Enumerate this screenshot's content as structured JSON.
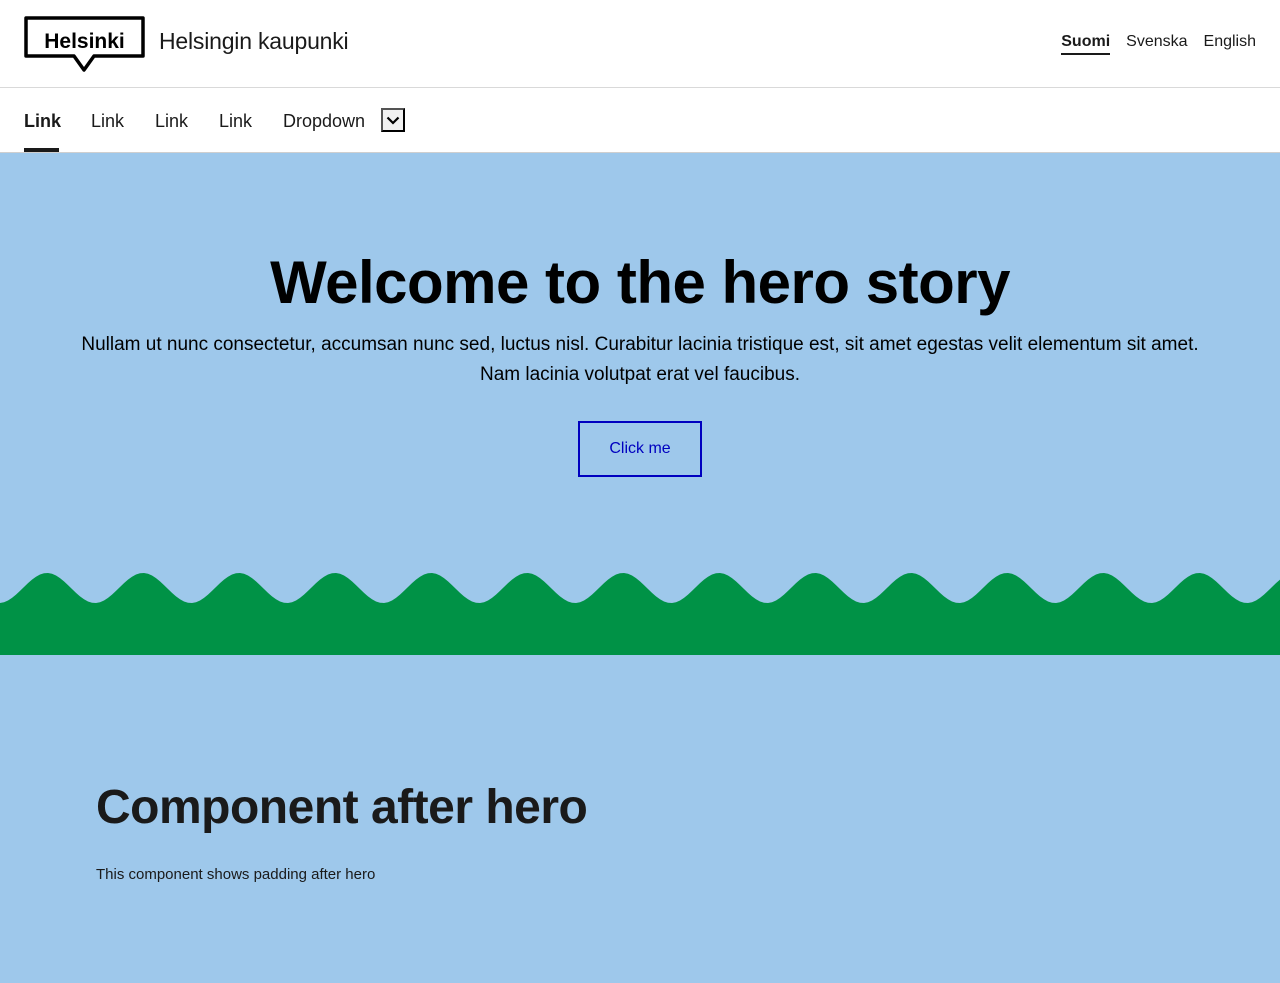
{
  "header": {
    "logo_text": "Helsinki",
    "site_title": "Helsingin kaupunki",
    "languages": [
      {
        "label": "Suomi",
        "active": true
      },
      {
        "label": "Svenska",
        "active": false
      },
      {
        "label": "English",
        "active": false
      }
    ]
  },
  "nav": {
    "items": [
      {
        "label": "Link",
        "active": true
      },
      {
        "label": "Link",
        "active": false
      },
      {
        "label": "Link",
        "active": false
      },
      {
        "label": "Link",
        "active": false
      },
      {
        "label": "Dropdown",
        "active": false
      }
    ],
    "dropdown_icon": "chevron-down-icon"
  },
  "hero": {
    "title": "Welcome to the hero story",
    "text": "Nullam ut nunc consectetur, accumsan nunc sed, luctus nisl. Curabitur lacinia tristique est, sit amet egestas velit elementum sit amet. Nam lacinia volutpat erat vel faucibus.",
    "button_label": "Click me",
    "background_color": "#9ec8eb",
    "koros_color": "#009246"
  },
  "after_hero": {
    "title": "Component after hero",
    "text": "This component shows padding after hero"
  },
  "colors": {
    "accent": "#0000bf",
    "text": "#1a1a1a"
  }
}
